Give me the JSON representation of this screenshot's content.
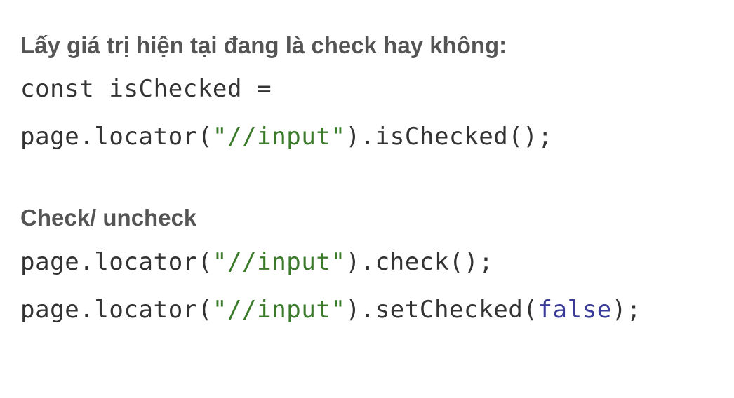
{
  "section_is_checked": {
    "heading": "Lấy giá trị hiện tại đang là check hay không:",
    "line1": "const isChecked =",
    "line2": {
      "prefix": "page.locator(",
      "string": "\"//input\"",
      "suffix": ").isChecked();"
    }
  },
  "section_check": {
    "heading": "Check/ uncheck",
    "line1": {
      "prefix": "page.locator(",
      "string": "\"//input\"",
      "suffix": ").check();"
    },
    "line2": {
      "prefix": "page.locator(",
      "string": "\"//input\"",
      "method": ").setChecked(",
      "keyword": "false",
      "suffix": ");"
    }
  },
  "colors": {
    "heading": "#555555",
    "code": "#333333",
    "string": "#3a7a2a",
    "keyword": "#3b3c99"
  }
}
